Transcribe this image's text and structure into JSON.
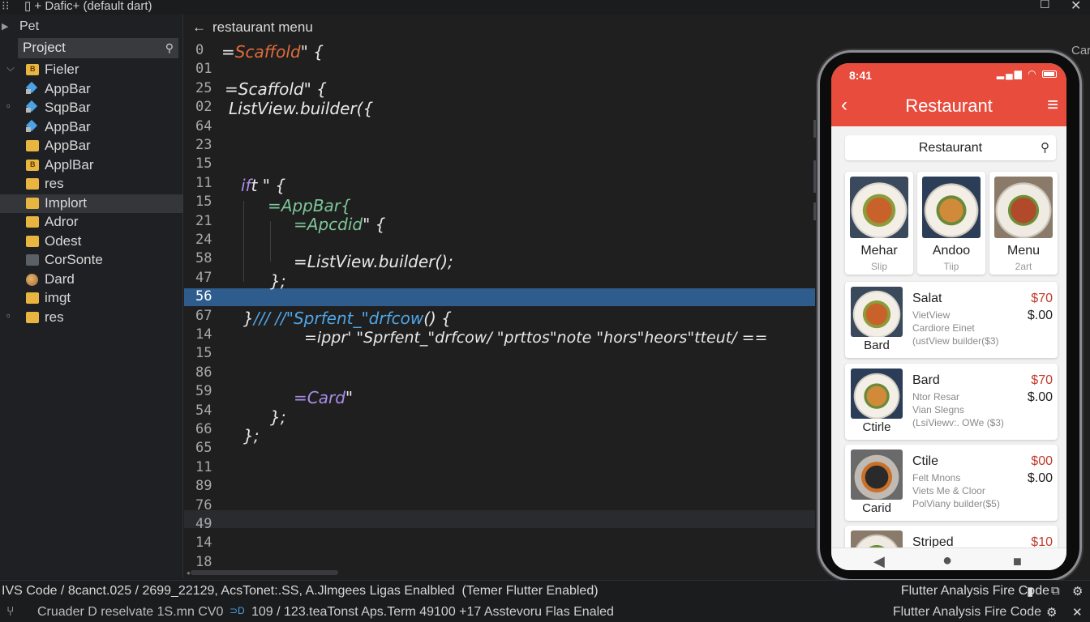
{
  "window": {
    "title": "Dafic+ (default dart)",
    "icons": [
      "menu-dots-icon",
      "file-icon",
      "plus-icon",
      "maximize-icon",
      "close-icon"
    ]
  },
  "sidebar": {
    "root_label": "Pet",
    "search_label": "Project",
    "items": [
      {
        "label": "Fieler",
        "icon": "folder-badge-icon",
        "chev": "expanded"
      },
      {
        "label": "AppBar",
        "icon": "dart-file-icon"
      },
      {
        "label": "SqpBar",
        "icon": "dart-file-icon",
        "chev": "box"
      },
      {
        "label": "AppBar",
        "icon": "dart-file-icon"
      },
      {
        "label": "AppBar",
        "icon": "folder-icon"
      },
      {
        "label": "ApplBar",
        "icon": "folder-badge-icon"
      },
      {
        "label": "res",
        "icon": "folder-icon"
      },
      {
        "label": "Implort",
        "icon": "folder-icon",
        "selected": true
      },
      {
        "label": "Adror",
        "icon": "folder-icon"
      },
      {
        "label": "Odest",
        "icon": "folder-icon"
      },
      {
        "label": "CorSonte",
        "icon": "gray-folder-icon"
      },
      {
        "label": "Dard",
        "icon": "globe-icon"
      },
      {
        "label": "imgt",
        "icon": "folder-icon"
      },
      {
        "label": "res",
        "icon": "folder-icon",
        "chev": "box"
      }
    ]
  },
  "editor": {
    "tab_title": "restaurant menu",
    "right_cut_label": "Car",
    "line_numbers": [
      "0",
      "01",
      "25",
      "02",
      "64",
      "23",
      "15",
      "11",
      "15",
      "21",
      "24",
      "58",
      "47",
      "56",
      "67",
      "14",
      "15",
      "86",
      "59",
      "54",
      "66",
      "65",
      "11",
      "89",
      "76",
      "49",
      "14",
      "18"
    ],
    "code": {
      "l0a": "=",
      "l0b": "Scaffold",
      "l0c": "\" {",
      "l2": "=Scaffold\" {",
      "l3": "ListView.builder({",
      "l7a": "if",
      "l7b": "t \" {",
      "l8": "=AppBar{",
      "l9a": "=Apcdid",
      "l9b": "\" {",
      "l11": "=ListView.builder();",
      "l12": "};",
      "l14a": "}",
      "l14b": "/// //\"Sprfent_\"drfcow",
      "l14c": "() {",
      "l15": "=ippr' \"Sprfent_\"drfcow/ \"prttos\"note \"hors\"heors\"tteut/ ==",
      "l18a": "=Card",
      "l18b": "\"",
      "l19": "};",
      "l20": "};"
    }
  },
  "phone": {
    "time": "8:41",
    "app_title": "Restaurant",
    "search_text": "Restaurant",
    "categories": [
      {
        "name": "Mehar",
        "sub": "Slip"
      },
      {
        "name": "Andoo",
        "sub": "Tiip"
      },
      {
        "name": "Menu",
        "sub": "2art"
      }
    ],
    "items": [
      {
        "image_label": "Bard",
        "title": "Salat",
        "desc1": "VietView",
        "desc2": "Cardiore Einet",
        "desc3": "(ustView builder($3)",
        "price": "$70",
        "price2": "$.00"
      },
      {
        "image_label": "Ctirle",
        "title": "Bard",
        "desc1": "Ntor Resar",
        "desc2": "Vian Slegns",
        "desc3": "(LsiViewv:. OWe ($3)",
        "price": "$70",
        "price2": "$.00"
      },
      {
        "image_label": "Carid",
        "title": "Ctile",
        "desc1": "Felt Mnons",
        "desc2": "Viets Me & Cloor",
        "desc3": "PolViany builder($5)",
        "price": "$00",
        "price2": "$.00"
      },
      {
        "image_label": "",
        "title": "Striped",
        "desc1": "",
        "desc2": "",
        "desc3": "",
        "price": "$10",
        "price2": ""
      }
    ]
  },
  "status_bar": {
    "left": "IVS Code / 8canct.025 / 2699_22129, AcsTonet:.SS, A.Jlmgees  Ligas Enalbled",
    "mid": "(Temer Flutter Enabled)",
    "right": "Flutter Analysis Fire Code",
    "line2_left": "⑂",
    "line2_mid": "Cruader D reselvate 1S.mn CV0",
    "line2_blue": "⊃D",
    "line2_mid2": "109 / 123.teaTonst Aps.Term 49100 +17 Asstevoru Flas Enaled",
    "line2_right": "Flutter Analysis Fire Code"
  }
}
